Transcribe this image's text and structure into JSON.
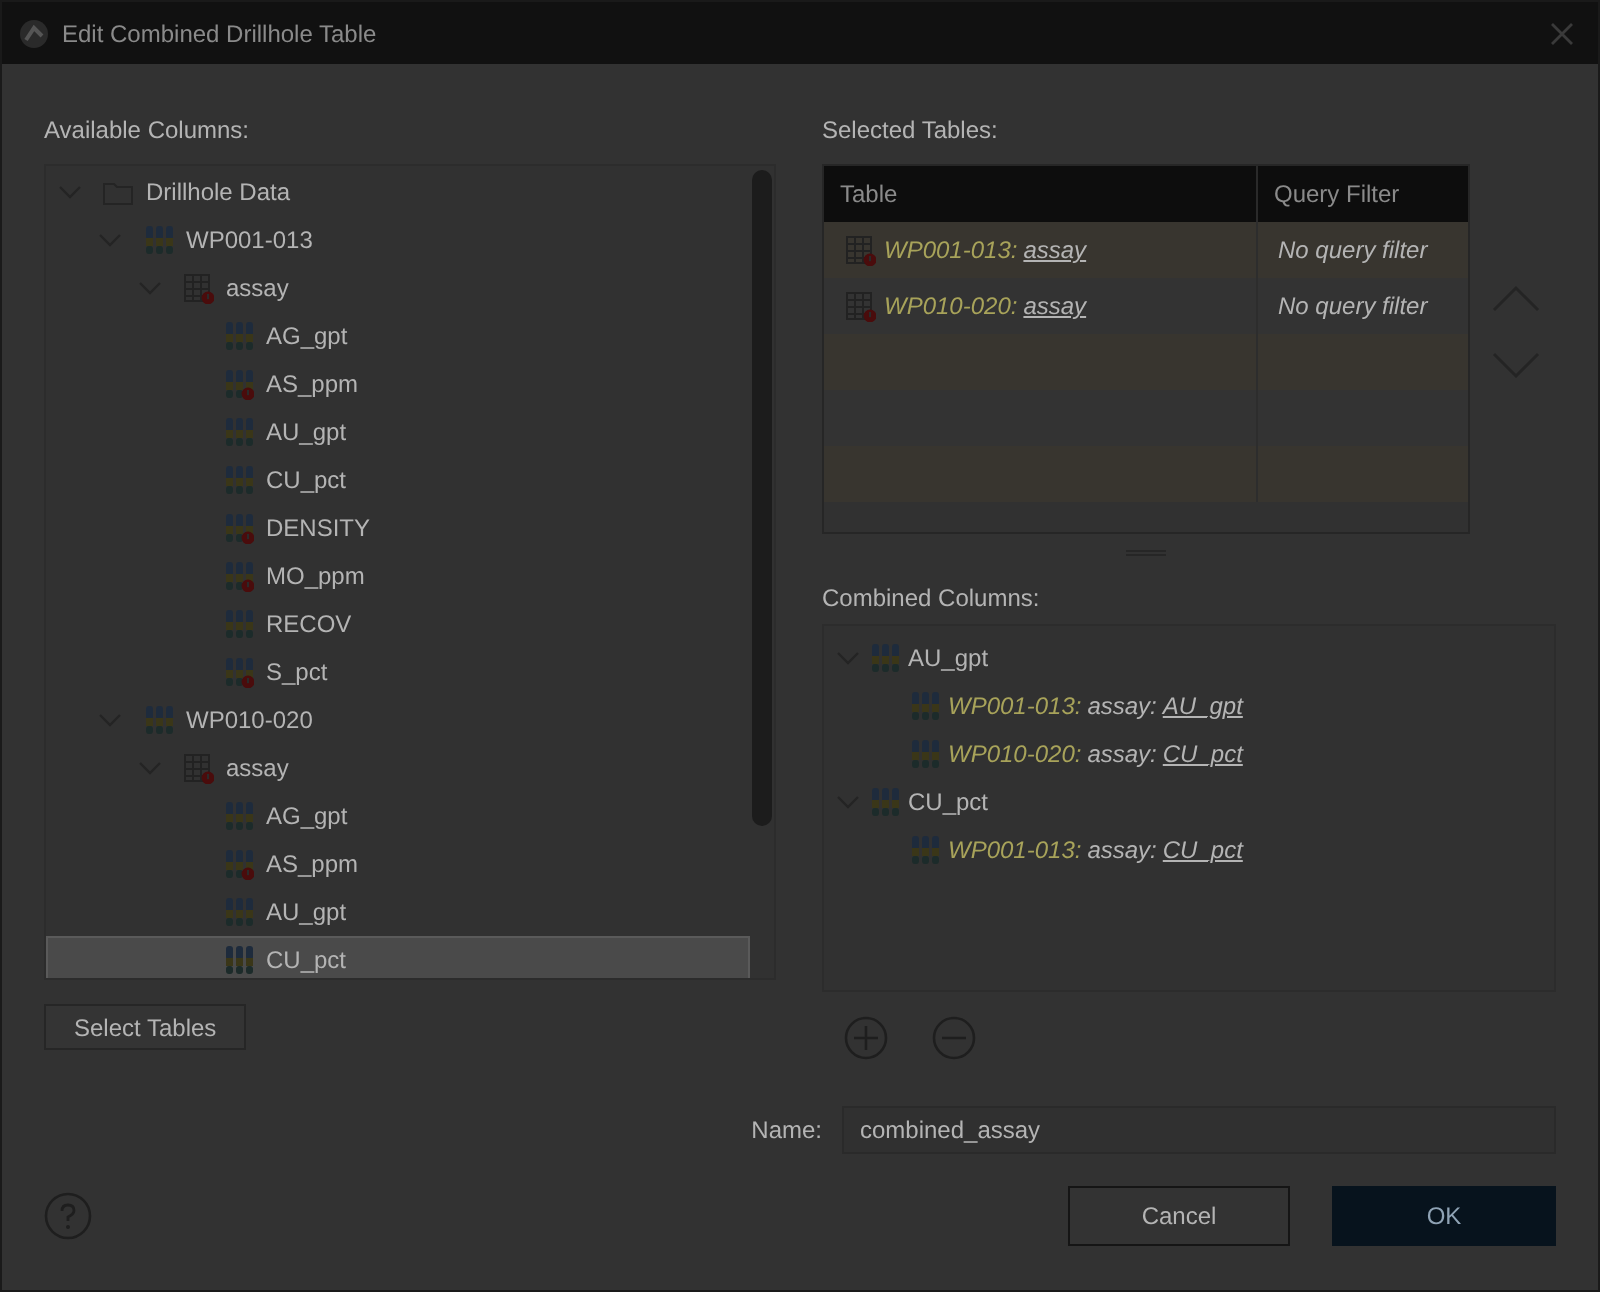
{
  "window": {
    "title": "Edit Combined Drillhole Table"
  },
  "available_columns": {
    "label": "Available Columns:",
    "tree": [
      {
        "label": "Drillhole Data",
        "kind": "folder",
        "warning": false,
        "expanded": true,
        "selected": false,
        "children": [
          {
            "label": "WP001-013",
            "kind": "drillholes",
            "warning": false,
            "expanded": true,
            "selected": false,
            "children": [
              {
                "label": "assay",
                "kind": "table",
                "warning": true,
                "expanded": true,
                "selected": false,
                "children": [
                  {
                    "label": "AG_gpt",
                    "kind": "column",
                    "warning": false,
                    "selected": false
                  },
                  {
                    "label": "AS_ppm",
                    "kind": "column",
                    "warning": true,
                    "selected": false
                  },
                  {
                    "label": "AU_gpt",
                    "kind": "column",
                    "warning": false,
                    "selected": false
                  },
                  {
                    "label": "CU_pct",
                    "kind": "column",
                    "warning": false,
                    "selected": false
                  },
                  {
                    "label": "DENSITY",
                    "kind": "column",
                    "warning": true,
                    "selected": false
                  },
                  {
                    "label": "MO_ppm",
                    "kind": "column",
                    "warning": true,
                    "selected": false
                  },
                  {
                    "label": "RECOV",
                    "kind": "column",
                    "warning": false,
                    "selected": false
                  },
                  {
                    "label": "S_pct",
                    "kind": "column",
                    "warning": true,
                    "selected": false
                  }
                ]
              }
            ]
          },
          {
            "label": "WP010-020",
            "kind": "drillholes",
            "warning": false,
            "expanded": true,
            "selected": false,
            "children": [
              {
                "label": "assay",
                "kind": "table",
                "warning": true,
                "expanded": true,
                "selected": false,
                "children": [
                  {
                    "label": "AG_gpt",
                    "kind": "column",
                    "warning": false,
                    "selected": false
                  },
                  {
                    "label": "AS_ppm",
                    "kind": "column",
                    "warning": true,
                    "selected": false
                  },
                  {
                    "label": "AU_gpt",
                    "kind": "column",
                    "warning": false,
                    "selected": false
                  },
                  {
                    "label": "CU_pct",
                    "kind": "column",
                    "warning": false,
                    "selected": true
                  }
                ]
              }
            ]
          }
        ]
      }
    ]
  },
  "select_tables_button": "Select Tables",
  "selected_tables": {
    "label": "Selected Tables:",
    "columns": [
      "Table",
      "Query Filter"
    ],
    "rows": [
      {
        "group": "WP001-013:",
        "table": "assay",
        "filter": "No query filter",
        "warning": true
      },
      {
        "group": "WP010-020:",
        "table": "assay",
        "filter": "No query filter",
        "warning": true
      }
    ]
  },
  "combined_columns": {
    "label": "Combined Columns:",
    "tree": [
      {
        "label": "AU_gpt",
        "expanded": true,
        "children": [
          {
            "group": "WP001-013:",
            "table": "assay:",
            "column": "AU_gpt"
          },
          {
            "group": "WP010-020:",
            "table": "assay:",
            "column": "CU_pct"
          }
        ]
      },
      {
        "label": "CU_pct",
        "expanded": true,
        "children": [
          {
            "group": "WP001-013:",
            "table": "assay:",
            "column": "CU_pct"
          }
        ]
      }
    ]
  },
  "name_field": {
    "label": "Name:",
    "value": "combined_assay"
  },
  "buttons": {
    "cancel": "Cancel",
    "ok": "OK"
  }
}
